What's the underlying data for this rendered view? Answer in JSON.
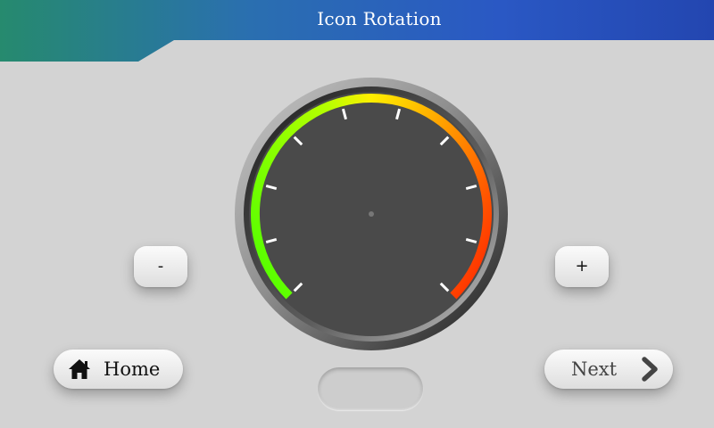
{
  "header": {
    "title": "Icon Rotation"
  },
  "gauge": {
    "value": null
  },
  "buttons": {
    "minus_label": "-",
    "plus_label": "+",
    "home_label": "Home",
    "next_label": "Next"
  },
  "colors": {
    "background": "#d3d3d3",
    "header_blue": "#2a55c2",
    "header_teal": "#268a6e",
    "dial_face": "#4a4a4a",
    "arc_green": "#4cff00",
    "arc_yellow": "#ffee00",
    "arc_red": "#ff2200"
  },
  "icons": {
    "home": "home-icon",
    "next": "chevron-right-icon"
  }
}
